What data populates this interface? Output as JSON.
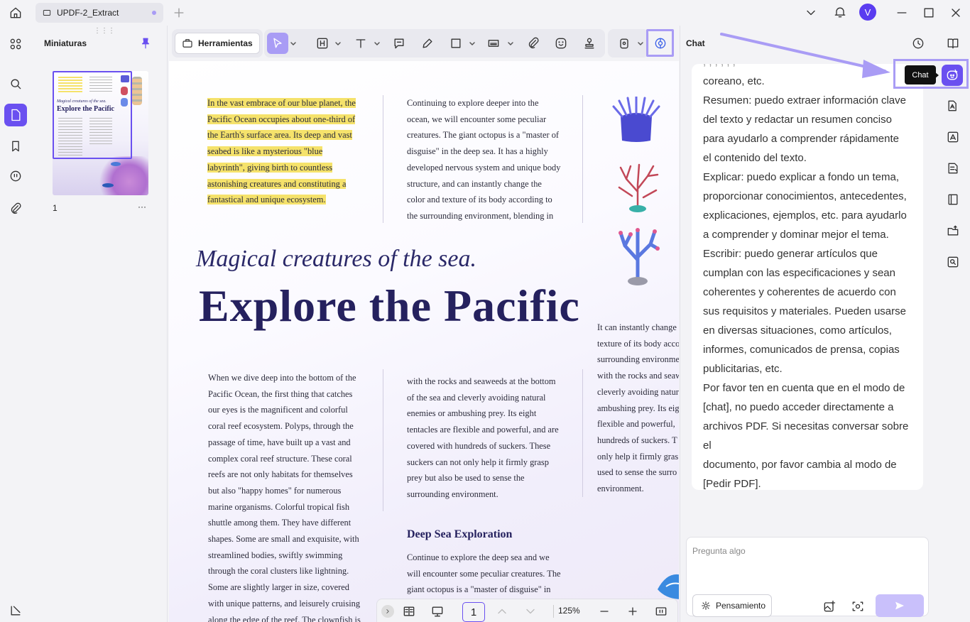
{
  "window": {
    "tab_title": "UPDF-2_Extract",
    "avatar_letter": "V"
  },
  "thumbnails": {
    "title": "Miniaturas",
    "page_number": "1",
    "more_label": "···"
  },
  "toolbar": {
    "tools_label": "Herramientas"
  },
  "document": {
    "col1_top": [
      "In the vast embrace of our blue planet, the",
      "Pacific Ocean occupies about one-third of",
      "the Earth's surface area. Its deep and vast",
      "seabed is like a mysterious \"blue",
      "labyrinth\", giving birth to countless",
      "astonishing creatures and constituting a",
      "fantastical and unique ecosystem."
    ],
    "col2_top": [
      "Continuing to explore deeper into the",
      "ocean, we will encounter some peculiar",
      "creatures. The giant octopus is a \"master of",
      "disguise\" in the deep sea. It has a highly",
      "developed nervous system and unique body",
      "structure, and can instantly change the",
      "color and texture of its body according to",
      "the surrounding environment, blending in"
    ],
    "subtitle": "Magical creatures of the sea.",
    "title": "Explore the Pacific",
    "col1_bottom": [
      "When we dive deep into the bottom of the",
      "Pacific Ocean, the first thing that catches",
      "our eyes is the magnificent and colorful",
      "coral reef ecosystem. Polyps, through the",
      "passage of time, have built up a vast and",
      "complex coral reef structure. These coral",
      "reefs are not only habitats for themselves",
      "but also \"happy homes\" for numerous",
      "marine organisms. Colorful tropical fish",
      "shuttle among them. They have different",
      "shapes. Some are small and exquisite, with",
      "streamlined bodies, swiftly swimming",
      "through the coral clusters like lightning.",
      "Some are slightly larger in size, covered",
      "with unique patterns, and leisurely cruising",
      "along the edge of the reef. The clownfish is"
    ],
    "col2_bottom": [
      "with the rocks and seaweeds at the bottom",
      "of the sea and cleverly avoiding natural",
      "enemies or ambushing prey. Its eight",
      "tentacles are flexible and powerful, and are",
      "covered with hundreds of suckers. These",
      "suckers can not only help it firmly grasp",
      "prey but also be used to sense the",
      "surrounding environment."
    ],
    "deep_sea_heading": "Deep Sea Exploration",
    "col2_deep": [
      "Continue to explore the deep sea and we",
      "will encounter some peculiar creatures. The",
      "giant octopus is a \"master of disguise\" in"
    ],
    "col3": [
      "It can instantly change",
      "texture of its body acco",
      "surrounding environme",
      "with the rocks and seaw",
      "cleverly avoiding natur",
      "ambushing prey. Its eig",
      "flexible and powerful,",
      "hundreds of suckers. T",
      "only help it firmly gras",
      "used to sense the surro",
      "environment."
    ]
  },
  "docbar": {
    "page": "1",
    "zoom": "125%"
  },
  "chat": {
    "title": "Chat",
    "tooltip": "Chat",
    "response_lines": [
      "coreano, etc.",
      "Resumen: puedo extraer información clave",
      "del texto y redactar un resumen conciso",
      "para ayudarlo a comprender rápidamente",
      "el contenido del texto.",
      "Explicar: puedo explicar a fondo un tema,",
      "proporcionar conocimientos, antecedentes,",
      "explicaciones, ejemplos, etc. para ayudarlo",
      "a comprender y dominar mejor el tema.",
      "Escribir: puedo generar artículos que",
      "cumplan con las especificaciones y sean",
      "coherentes y coherentes de acuerdo con",
      "sus requisitos y materiales. Pueden usarse",
      "en diversas situaciones, como artículos,",
      "informes, comunicados de prensa, copias",
      "publicitarias, etc.",
      "Por favor ten en cuenta que en el modo de",
      "[chat], no puedo acceder directamente a",
      "archivos PDF. Si necesitas conversar sobre el",
      "documento, por favor cambia al modo de",
      "[Pedir PDF]."
    ],
    "input_placeholder": "Pregunta algo",
    "thinking_label": "Pensamiento"
  },
  "colors": {
    "accent": "#6a50f0",
    "accent_light": "#a99cf5",
    "highlight": "#f5e26b",
    "title_navy": "#25215e"
  }
}
